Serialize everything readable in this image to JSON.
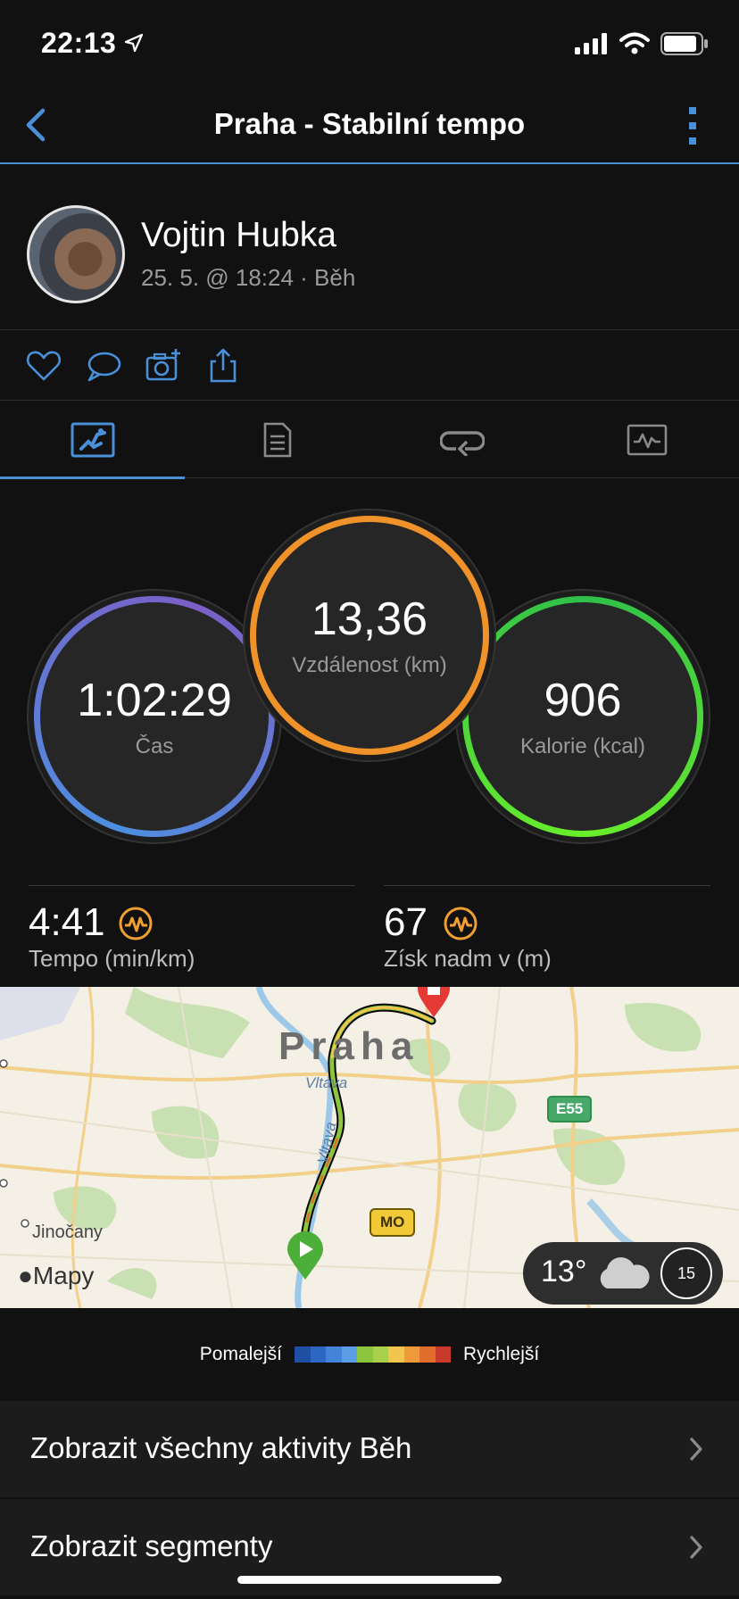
{
  "status": {
    "time": "22:13"
  },
  "nav": {
    "title": "Praha - Stabilní tempo"
  },
  "profile": {
    "name": "Vojtin Hubka",
    "subtitle": "25. 5. @ 18:24 · Běh"
  },
  "metrics": {
    "time": {
      "value": "1:02:29",
      "label": "Čas"
    },
    "distance": {
      "value": "13,36",
      "label": "Vzdálenost (km)"
    },
    "calories": {
      "value": "906",
      "label": "Kalorie (kcal)"
    }
  },
  "stats": {
    "pace": {
      "value": "4:41",
      "label": "Tempo (min/km)"
    },
    "elevation": {
      "value": "67",
      "label": "Získ nadm v (m)"
    }
  },
  "map": {
    "city": "Praha",
    "river": "Vltava",
    "river_vertical": "Vltava",
    "town": "Jinočany",
    "road_e55": "E55",
    "road_mo": "MO",
    "logo": "Mapy",
    "weather_temp": "13°",
    "aqi": "15"
  },
  "legend": {
    "slower": "Pomalejší",
    "faster": "Rychlejší",
    "colors": [
      "#1f4fa3",
      "#2e66c4",
      "#4384d8",
      "#5b9de6",
      "#8cc63f",
      "#a9d04a",
      "#f1c54e",
      "#ef9a3a",
      "#e06d2c",
      "#c93a2a"
    ]
  },
  "rows": {
    "all_activities": "Zobrazit všechny aktivity Běh",
    "segments": "Zobrazit segmenty"
  },
  "colors": {
    "accent": "#4a90d9",
    "distance_ring": "#f0922a",
    "calories_ring": "#3ecf4c",
    "stat_icon": "#f0a030"
  }
}
